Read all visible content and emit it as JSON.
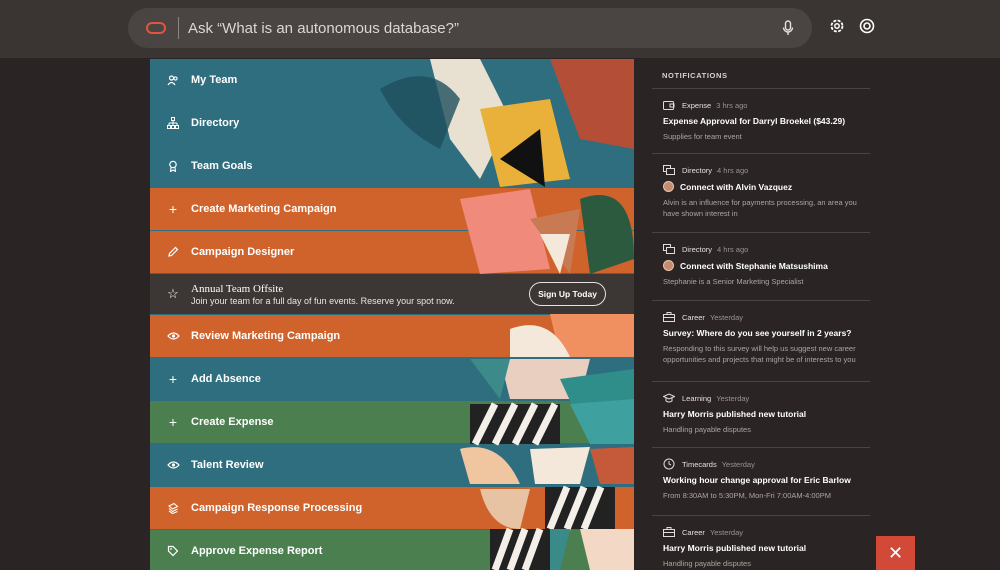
{
  "search": {
    "placeholder": "Ask “What is an autonomous database?”"
  },
  "menu": [
    {
      "label": "My Team",
      "icon": "people-icon",
      "color": "#2f6e7e"
    },
    {
      "label": "Directory",
      "icon": "org-chart-icon",
      "color": "#2f6e7e"
    },
    {
      "label": "Team Goals",
      "icon": "award-icon",
      "color": "#2f6e7e"
    },
    {
      "label": "Create Marketing Campaign",
      "icon": "plus-icon",
      "color": "#d0632c"
    },
    {
      "label": "Campaign Designer",
      "icon": "pencil-icon",
      "color": "#d0632c"
    },
    {
      "label": "Review Marketing Campaign",
      "icon": "eye-icon",
      "color": "#d0632c"
    },
    {
      "label": "Add Absence",
      "icon": "plus-icon",
      "color": "#2f6e7e"
    },
    {
      "label": "Create Expense",
      "icon": "plus-icon",
      "color": "#4b7f50"
    },
    {
      "label": "Talent Review",
      "icon": "eye-icon",
      "color": "#2f6e7e"
    },
    {
      "label": "Campaign Response Processing",
      "icon": "stack-icon",
      "color": "#d0632c"
    },
    {
      "label": "Approve Expense Report",
      "icon": "tag-icon",
      "color": "#4b7f50"
    }
  ],
  "banner": {
    "title": "Annual Team Offsite",
    "text": "Join your team for a full day of fun events. Reserve your spot now.",
    "button": "Sign Up Today"
  },
  "notifications": {
    "title": "NOTIFICATIONS",
    "items": [
      {
        "category": "Expense",
        "time": "3 hrs ago",
        "title": "Expense Approval for Darryl Broekel ($43.29)",
        "subtitle": "Supplies for team event",
        "icon": "wallet-icon"
      },
      {
        "category": "Directory",
        "time": "4 hrs ago",
        "title": "Connect with Alvin Vazquez",
        "subtitle": "Alvin is an influence for payments processing, an area you have shown interest in",
        "icon": "directory-icon"
      },
      {
        "category": "Directory",
        "time": "4 hrs ago",
        "title": "Connect with Stephanie Matsushima",
        "subtitle": "Stephanie is a Senior Marketing Specialist",
        "icon": "directory-icon"
      },
      {
        "category": "Career",
        "time": "Yesterday",
        "title": "Survey: Where do you see yourself in 2 years?",
        "subtitle": "Responding to this survey will help us suggest new career opportunities and projects that might be of interests to you",
        "icon": "briefcase-icon"
      },
      {
        "category": "Learning",
        "time": "Yesterday",
        "title": "Harry Morris published new tutorial",
        "subtitle": "Handling payable disputes",
        "icon": "graduation-cap-icon"
      },
      {
        "category": "Timecards",
        "time": "Yesterday",
        "title": "Working hour change approval for Eric Barlow",
        "subtitle": "From 8:30AM to 5:30PM, Mon-Fri 7:00AM-4:00PM",
        "icon": "clock-icon"
      },
      {
        "category": "Career",
        "time": "Yesterday",
        "title": "Harry Morris published new tutorial",
        "subtitle": "Handling payable disputes",
        "icon": "briefcase-icon"
      }
    ]
  },
  "close": {
    "label": "✕"
  }
}
